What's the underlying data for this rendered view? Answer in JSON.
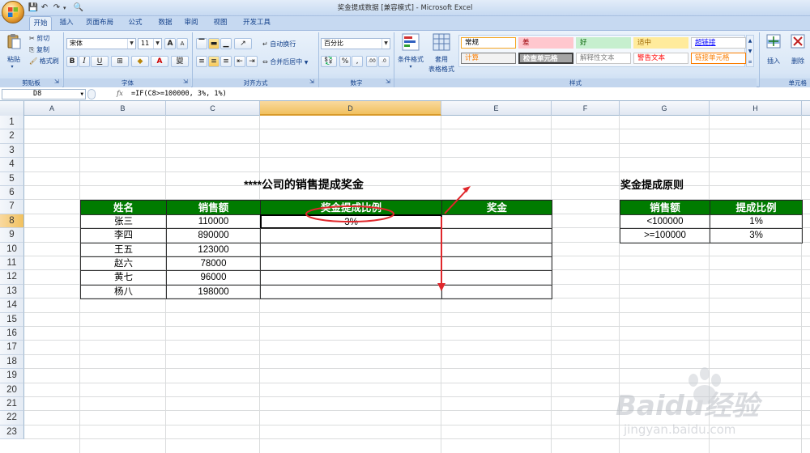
{
  "window": {
    "title": "奖金提成数据  [兼容模式] - Microsoft Excel",
    "quick_access": [
      {
        "icon": "save-icon",
        "glyph": "💾"
      },
      {
        "icon": "undo-icon",
        "glyph": "↶"
      },
      {
        "icon": "redo-icon",
        "glyph": "↷"
      },
      {
        "icon": "print-preview-icon",
        "glyph": "🔍"
      }
    ]
  },
  "ribbon_tabs": [
    "开始",
    "插入",
    "页面布局",
    "公式",
    "数据",
    "审阅",
    "视图",
    "开发工具"
  ],
  "ribbon": {
    "clipboard": {
      "paste": "粘贴",
      "cut": "剪切",
      "copy": "复制",
      "format_painter": "格式刷",
      "label": "剪贴板"
    },
    "font": {
      "name": "宋体",
      "size": "11",
      "label": "字体",
      "bold": "B",
      "italic": "I",
      "underline": "U",
      "grow": "A",
      "shrink": "A",
      "phonetic": "變"
    },
    "alignment": {
      "wrap": "自动换行",
      "merge": "合并后居中",
      "label": "对齐方式"
    },
    "number": {
      "format": "百分比",
      "percent": "%",
      "comma": ",",
      "inc": ".00",
      "dec": ".0",
      "label": "数字"
    },
    "styles": {
      "conditional": "条件格式",
      "table": "套用",
      "table2": "表格格式",
      "cells": [
        {
          "label": "常规",
          "bg": "#ffffff",
          "color": "#000000",
          "border": "#f5a623"
        },
        {
          "label": "差",
          "bg": "#ffc7ce",
          "color": "#9c0006",
          "border": "#ffc7ce"
        },
        {
          "label": "好",
          "bg": "#c6efce",
          "color": "#006100",
          "border": "#c6efce"
        },
        {
          "label": "适中",
          "bg": "#ffeb9c",
          "color": "#9c6500",
          "border": "#ffeb9c"
        },
        {
          "label": "超链接",
          "bg": "#ffffff",
          "color": "#0000ff",
          "border": "#c8c8c8"
        },
        {
          "label": "计算",
          "bg": "#f2f2f2",
          "color": "#fa7d00",
          "border": "#7f7f7f"
        },
        {
          "label": "检查单元格",
          "bg": "#a5a5a5",
          "color": "#ffffff",
          "border": "#3f3f3f"
        },
        {
          "label": "解释性文本",
          "bg": "#ffffff",
          "color": "#7f7f7f",
          "border": "#c8c8c8"
        },
        {
          "label": "警告文本",
          "bg": "#ffffff",
          "color": "#ff0000",
          "border": "#c8c8c8"
        },
        {
          "label": "链接单元格",
          "bg": "#ffffff",
          "color": "#fa7d00",
          "border": "#fa7d00"
        }
      ],
      "label": "样式"
    },
    "cells": {
      "insert": "插入",
      "delete": "删除",
      "label": "单元格"
    }
  },
  "formula_bar": {
    "name_box": "D8",
    "fx": "fx",
    "formula": "=IF(C8>=100000, 3%, 1%)"
  },
  "columns": [
    "A",
    "B",
    "C",
    "D",
    "E",
    "F",
    "G",
    "H"
  ],
  "rows": [
    "1",
    "2",
    "3",
    "4",
    "5",
    "6",
    "7",
    "8",
    "9",
    "10",
    "11",
    "12",
    "13",
    "14",
    "15",
    "16",
    "17",
    "18",
    "19",
    "20",
    "21",
    "22",
    "23"
  ],
  "main_table": {
    "title": "****公司的销售提成奖金",
    "headers": [
      "姓名",
      "销售额",
      "奖金提成比例",
      "奖金"
    ],
    "rows": [
      {
        "name": "张三",
        "sales": "110000",
        "rate": "3%",
        "bonus": ""
      },
      {
        "name": "李四",
        "sales": "890000",
        "rate": "",
        "bonus": ""
      },
      {
        "name": "王五",
        "sales": "123000",
        "rate": "",
        "bonus": ""
      },
      {
        "name": "赵六",
        "sales": "78000",
        "rate": "",
        "bonus": ""
      },
      {
        "name": "黄七",
        "sales": "96000",
        "rate": "",
        "bonus": ""
      },
      {
        "name": "杨八",
        "sales": "198000",
        "rate": "",
        "bonus": ""
      }
    ]
  },
  "rule_table": {
    "title": "奖金提成原则",
    "headers": [
      "销售额",
      "提成比例"
    ],
    "rows": [
      {
        "condition": "<100000",
        "rate": "1%"
      },
      {
        "condition": ">=100000",
        "rate": "3%"
      }
    ]
  },
  "watermark": {
    "brand": "Baidu经验",
    "url": "jingyan.baidu.com"
  },
  "colors": {
    "header_green": "#007b00",
    "annotation_red": "#e0272b",
    "selected_col": "#f9d99f"
  }
}
